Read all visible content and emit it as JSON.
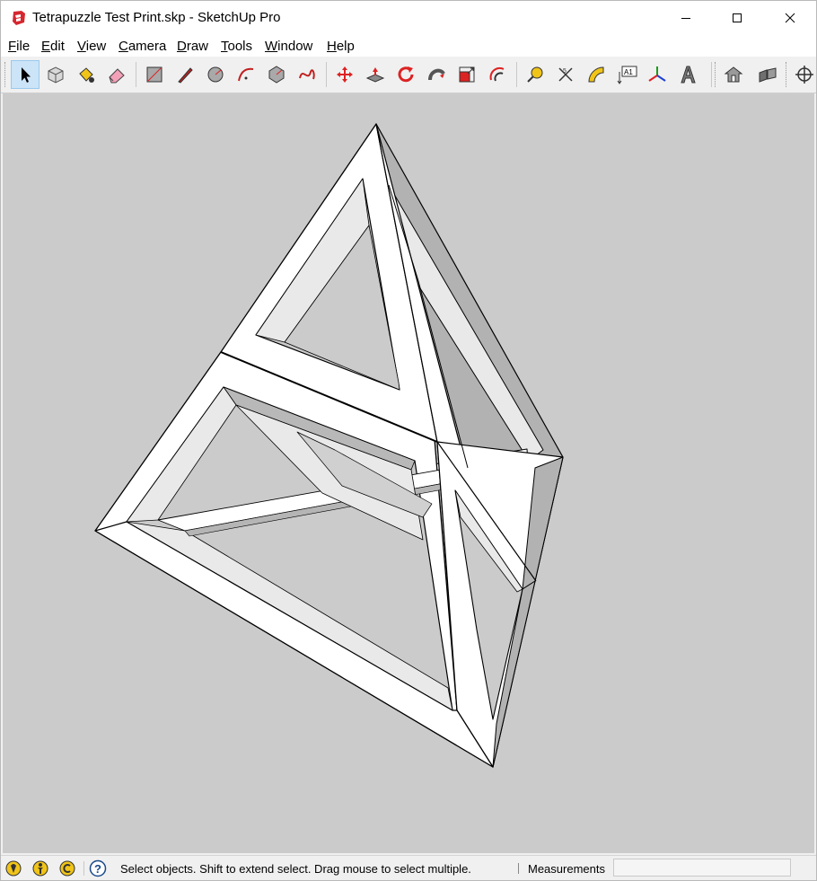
{
  "window": {
    "title": "Tetrapuzzle Test Print.skp - SketchUp Pro",
    "app_icon": "sketchup-logo-icon",
    "controls": [
      "minimize-icon",
      "maximize-icon",
      "close-icon"
    ]
  },
  "menubar": [
    {
      "accel": "F",
      "rest": "ile"
    },
    {
      "accel": "E",
      "rest": "dit"
    },
    {
      "accel": "V",
      "rest": "iew"
    },
    {
      "accel": "C",
      "rest": "amera"
    },
    {
      "accel": "D",
      "rest": "raw"
    },
    {
      "accel": "T",
      "rest": "ools"
    },
    {
      "accel": "W",
      "rest": "indow"
    },
    {
      "accel": "H",
      "rest": "elp"
    }
  ],
  "toolbar": {
    "tools": [
      "select-icon",
      "make-component-icon",
      "paint-bucket-icon",
      "eraser-icon",
      "rectangle-icon",
      "line-icon",
      "circle-icon",
      "arc-icon",
      "polygon-icon",
      "freehand-icon",
      "move-icon",
      "push-pull-icon",
      "rotate-icon",
      "follow-me-icon",
      "scale-icon",
      "offset-icon",
      "tape-measure-icon",
      "dimension-icon",
      "protractor-icon",
      "text-icon",
      "axes-icon",
      "3d-text-icon",
      "warehouse-icon",
      "extension-warehouse-icon",
      "orbit-icon"
    ],
    "selected": "select-icon",
    "text_tool_label": "A1"
  },
  "model": {
    "name": "tetrahedral frame puzzle",
    "face_color": "#ffffff",
    "inner_face_color": "#e9e9e9",
    "shade_color": "#b2b2b2",
    "edge_color": "#000000",
    "background_color": "#cbcbcb"
  },
  "statusbar": {
    "icons": [
      "geo-location-icon",
      "credits-icon",
      "license-icon",
      "help-icon"
    ],
    "message": "Select objects. Shift to extend select. Drag mouse to select multiple.",
    "measurements_label": "Measurements",
    "measurements_value": ""
  }
}
